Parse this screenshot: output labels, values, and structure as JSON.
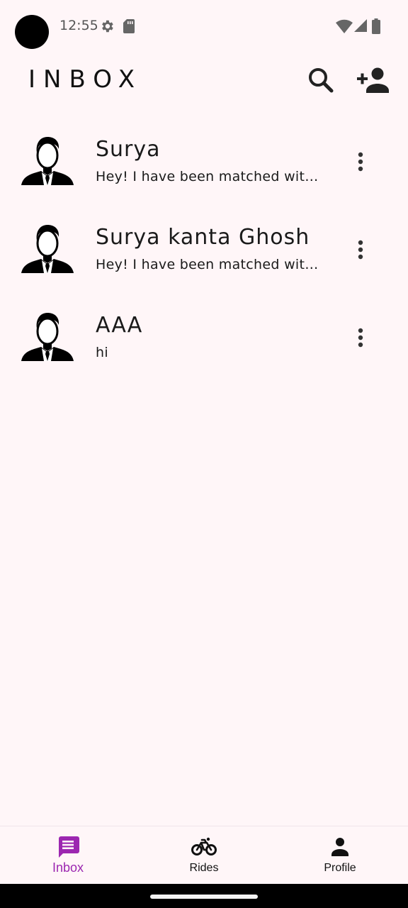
{
  "status_bar": {
    "time": "12:55",
    "icons": [
      "gear-icon",
      "sd-card-icon",
      "wifi-icon",
      "signal-icon",
      "battery-icon"
    ]
  },
  "app_bar": {
    "title": "INBOX",
    "actions": [
      "search-icon",
      "add-person-icon"
    ]
  },
  "chats": [
    {
      "name": "Surya",
      "preview": "Hey! I have been matched with you for a ride"
    },
    {
      "name": "Surya kanta Ghosh",
      "preview": "Hey! I have been matched with you for a ride"
    },
    {
      "name": "AAA",
      "preview": "hi"
    }
  ],
  "bottom_nav": {
    "items": [
      {
        "label": "Inbox",
        "icon": "message-icon",
        "active": true
      },
      {
        "label": "Rides",
        "icon": "bicycle-icon",
        "active": false
      },
      {
        "label": "Profile",
        "icon": "person-icon",
        "active": false
      }
    ]
  },
  "colors": {
    "background": "#fff6f8",
    "accent": "#9c27b0",
    "text": "#1a1a1a"
  }
}
